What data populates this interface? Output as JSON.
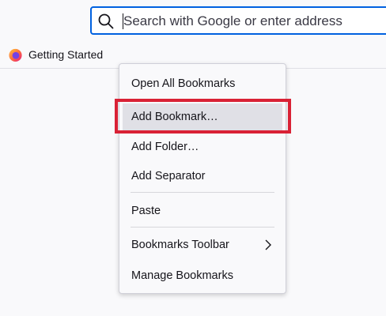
{
  "address_bar": {
    "placeholder": "Search with Google or enter address",
    "value": ""
  },
  "bookmarks_toolbar": {
    "items": [
      {
        "label": "Getting Started",
        "icon": "firefox-icon"
      }
    ]
  },
  "context_menu": {
    "items": [
      {
        "label": "Open All Bookmarks"
      },
      {
        "label": "Add Bookmark…",
        "hovered": true,
        "annotated": true
      },
      {
        "label": "Add Folder…"
      },
      {
        "label": "Add Separator"
      },
      {
        "label": "Paste"
      },
      {
        "label": "Bookmarks Toolbar",
        "has_submenu": true
      },
      {
        "label": "Manage Bookmarks"
      }
    ]
  },
  "colors": {
    "accent": "#0061e0",
    "annotation": "#d92135",
    "hover": "#e0e0e6",
    "background": "#f9f9fb"
  }
}
